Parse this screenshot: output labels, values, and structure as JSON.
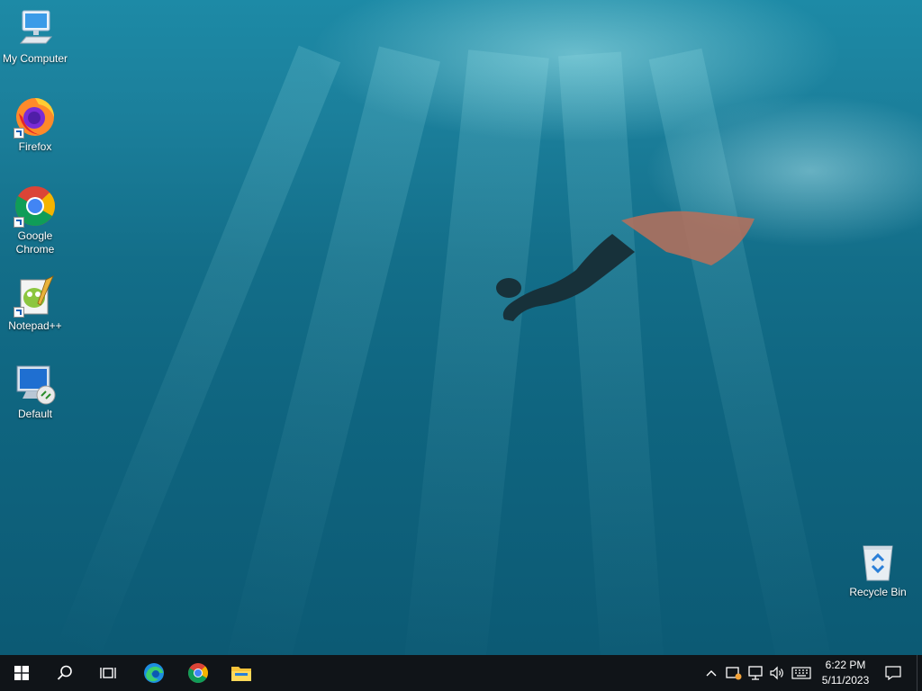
{
  "desktop": {
    "icons": [
      {
        "label": "My Computer",
        "icon": "computer-icon"
      },
      {
        "label": "Firefox",
        "icon": "firefox-icon"
      },
      {
        "label": "Google Chrome",
        "icon": "chrome-icon"
      },
      {
        "label": "Notepad++",
        "icon": "notepad-plus-plus-icon"
      },
      {
        "label": "Default",
        "icon": "remote-desktop-icon"
      },
      {
        "label": "Recycle Bin",
        "icon": "recycle-bin-icon"
      }
    ]
  },
  "taskbar": {
    "start": "windows-logo-icon",
    "search": "search-icon",
    "task_view": "task-view-icon",
    "pinned": [
      {
        "name": "Microsoft Edge",
        "icon": "edge-icon"
      },
      {
        "name": "Google Chrome",
        "icon": "chrome-icon"
      },
      {
        "name": "File Explorer",
        "icon": "file-explorer-icon"
      }
    ],
    "tray": {
      "icons": [
        "chevron-up-icon",
        "security-alert-icon",
        "network-icon",
        "volume-icon",
        "keyboard-icon"
      ],
      "time": "6:22 PM",
      "date": "5/11/2023",
      "notification_icon": "notification-icon"
    }
  },
  "colors": {
    "taskbar_bg": "#101418",
    "water_top": "#1d8aa6",
    "water_bottom": "#0c5a74"
  }
}
